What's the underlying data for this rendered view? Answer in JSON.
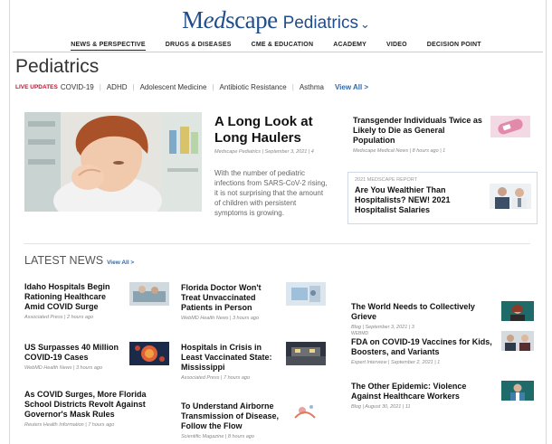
{
  "brand": {
    "logo_pre": "M",
    "logo_ed": "ed",
    "logo_post": "scape",
    "section": "Pediatrics",
    "chevron": "⌄"
  },
  "nav": [
    "NEWS & PERSPECTIVE",
    "DRUGS & DISEASES",
    "CME & EDUCATION",
    "ACADEMY",
    "VIDEO",
    "DECISION POINT"
  ],
  "page_title": "Pediatrics",
  "topics": {
    "live": "LIVE UPDATES",
    "items": [
      "COVID-19",
      "ADHD",
      "Adolescent Medicine",
      "Antibiotic Resistance",
      "Asthma"
    ],
    "view_all": "View All >"
  },
  "feature": {
    "title": "A Long Look at Long Haulers",
    "meta": "Medscape Pediatrics | September 3, 2021 | 4",
    "desc": "With the number of pediatric infections from SARS-CoV-2 rising, it is not surprising that the amount of children with persistent symptoms is growing."
  },
  "right_top": [
    {
      "title": "Transgender Individuals Twice as Likely to Die as General Population",
      "meta": "Medscape Medical News | 8 hours ago | 1"
    }
  ],
  "report": {
    "kicker": "2021 MEDSCAPE REPORT",
    "title": "Are You Wealthier Than Hospitalists? NEW! 2021 Hospitalist Salaries"
  },
  "latest": {
    "heading": "LATEST NEWS",
    "view_all": "View All >"
  },
  "stories_left": [
    {
      "title": "Idaho Hospitals Begin Rationing Healthcare Amid COVID Surge",
      "meta": "Associated Press | 2 hours ago"
    },
    {
      "title": "US Surpasses 40 Million COVID-19 Cases",
      "meta": "WebMD Health News | 3 hours ago"
    },
    {
      "title": "As COVID Surges, More Florida School Districts Revolt Against Governor's Mask Rules",
      "meta": "Reuters Health Information | 7 hours ago"
    }
  ],
  "stories_mid": [
    {
      "title": "Florida Doctor Won't Treat Unvaccinated Patients in Person",
      "meta": "WebMD Health News | 3 hours ago"
    },
    {
      "title": "Hospitals in Crisis in Least Vaccinated State: Mississippi",
      "meta": "Associated Press | 7 hours ago"
    },
    {
      "title": "To Understand Airborne Transmission of Disease, Follow the Flow",
      "meta": "Scientific Magazine | 8 hours ago"
    }
  ],
  "stories_right": [
    {
      "kicker": "",
      "title": "The World Needs to Collectively Grieve",
      "meta": "Blog | September 3, 2021 | 3"
    },
    {
      "kicker": "WEBMD",
      "title": "FDA on COVID-19 Vaccines for Kids, Boosters, and Variants",
      "meta": "Expert Interview | September 2, 2021 | 1"
    },
    {
      "kicker": "",
      "title": "The Other Epidemic: Violence Against Healthcare Workers",
      "meta": "Blog | August 30, 2021 | 11"
    }
  ],
  "colors": {
    "brand": "#1f4e8c",
    "live": "#c8102e",
    "link": "#2a6ab0"
  }
}
